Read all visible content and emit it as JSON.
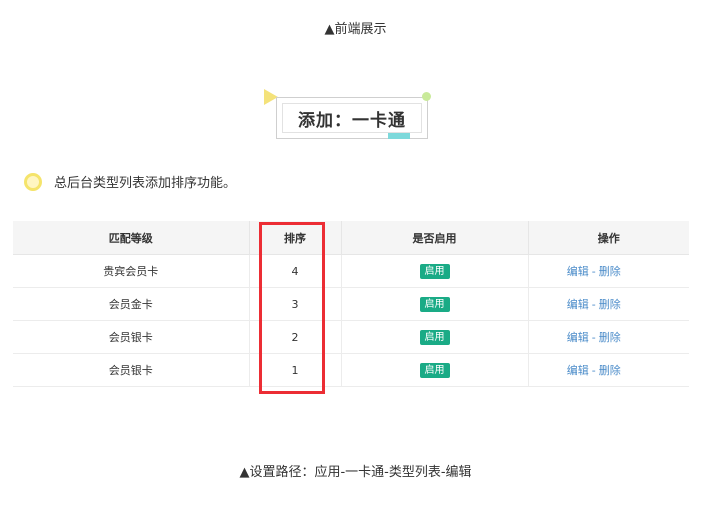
{
  "caption_top": "▲前端展示",
  "section_title": "添加：一卡通",
  "note": "总后台类型列表添加排序功能。",
  "table": {
    "headers": [
      "匹配等级",
      "排序",
      "是否启用",
      "操作"
    ],
    "rows": [
      {
        "level": "贵宾会员卡",
        "sort": "4",
        "status": "启用"
      },
      {
        "level": "会员金卡",
        "sort": "3",
        "status": "启用"
      },
      {
        "level": "会员银卡",
        "sort": "2",
        "status": "启用"
      },
      {
        "level": "会员银卡",
        "sort": "1",
        "status": "启用"
      }
    ],
    "edit_label": "编辑",
    "op_sep": "-",
    "delete_label": "删除"
  },
  "caption_bottom": "▲设置路径：应用-一卡通-类型列表-编辑",
  "colors": {
    "badge": "#1aab86",
    "link": "#4a8bc9",
    "highlight": "#ec2d34",
    "deco_yellow": "#f4e27a",
    "deco_teal": "#7dd9db",
    "deco_green": "#c9ea9a"
  }
}
